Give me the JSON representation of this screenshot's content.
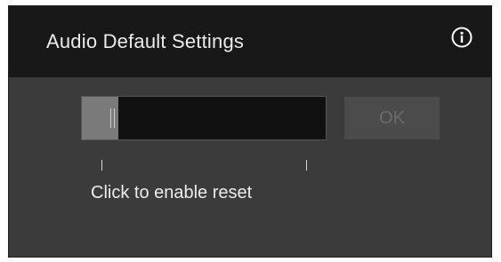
{
  "dialog": {
    "title": "Audio Default Settings",
    "info_icon": "info-circle-icon"
  },
  "slider": {
    "fill_fraction": 0.15,
    "thumb_icon": "grip-icon"
  },
  "ok_button": {
    "label": "OK",
    "enabled": false
  },
  "reset": {
    "label": "Click to enable reset"
  },
  "colors": {
    "header_bg": "#181818",
    "body_bg": "#3b3b3b",
    "track_bg": "#111111",
    "fill": "#7a7a7a",
    "text": "#ececec",
    "disabled_button_bg": "#4b4b4b",
    "disabled_button_text": "#6a6a6a"
  }
}
